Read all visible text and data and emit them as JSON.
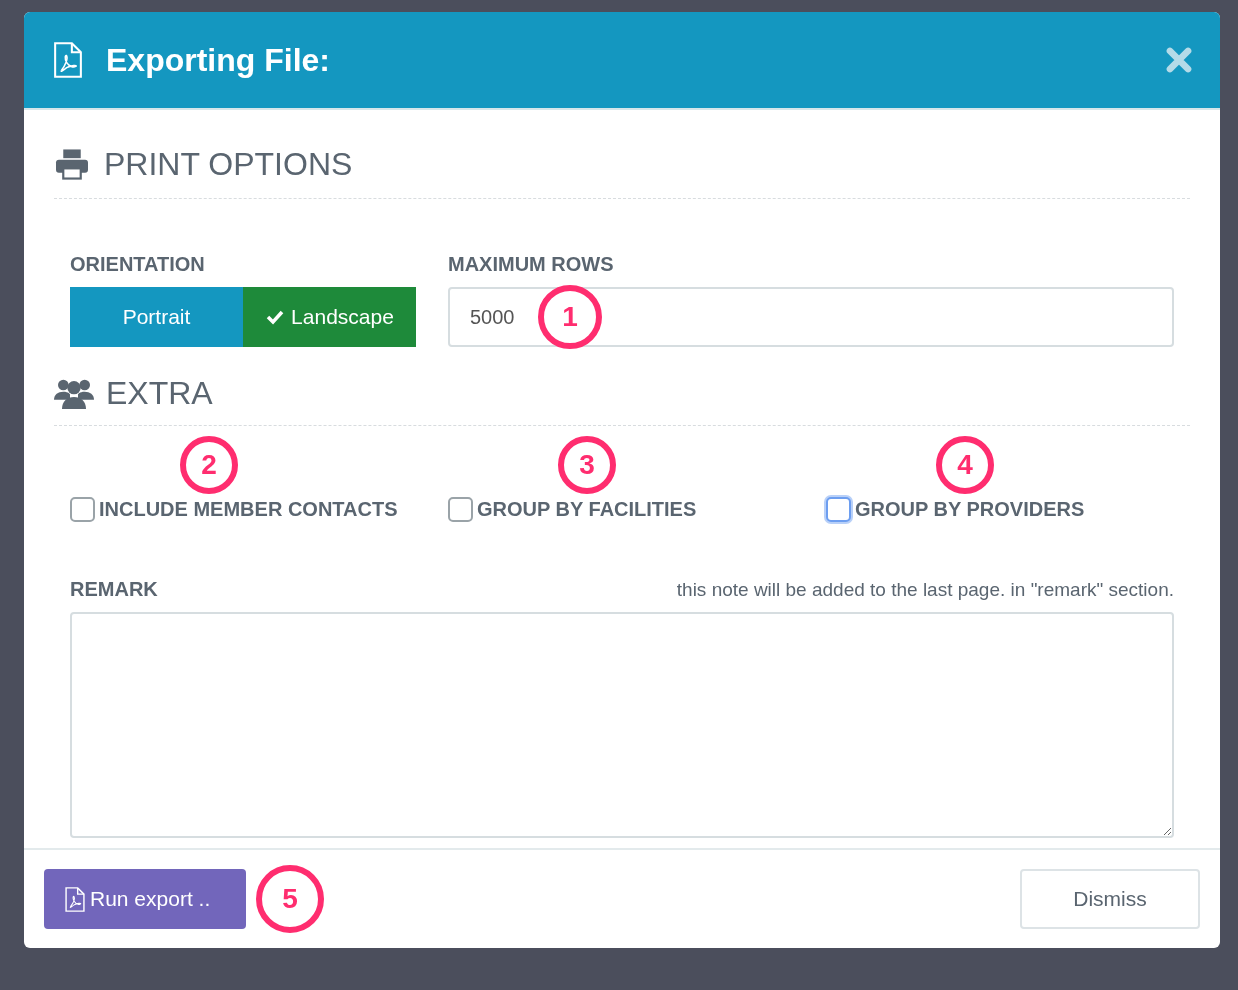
{
  "dialog": {
    "title": "Exporting File:"
  },
  "print_options": {
    "heading": "PRINT OPTIONS",
    "orientation": {
      "label": "ORIENTATION",
      "options": [
        {
          "label": "Portrait",
          "selected": false
        },
        {
          "label": "Landscape",
          "selected": true
        }
      ]
    },
    "max_rows": {
      "label": "MAXIMUM ROWS",
      "value": "5000",
      "callout": "1"
    }
  },
  "extra": {
    "heading": "EXTRA",
    "options": [
      {
        "label": "INCLUDE MEMBER CONTACTS",
        "checked": false,
        "focused": false,
        "callout": "2"
      },
      {
        "label": "GROUP BY FACILITIES",
        "checked": false,
        "focused": false,
        "callout": "3"
      },
      {
        "label": "GROUP BY PROVIDERS",
        "checked": false,
        "focused": true,
        "callout": "4"
      }
    ],
    "remark": {
      "label": "REMARK",
      "hint": "this note will be added to the last page. in \"remark\" section."
    }
  },
  "footer": {
    "run_button": {
      "label": "Run export ..",
      "callout": "5"
    },
    "dismiss_button": {
      "label": "Dismiss"
    }
  }
}
